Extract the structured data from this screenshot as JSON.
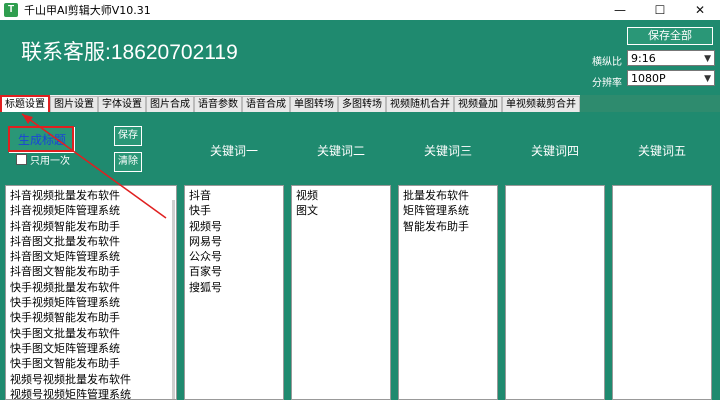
{
  "window": {
    "title": "千山甲AI剪辑大师V10.31",
    "icon_letter": "T",
    "min": "—",
    "max": "☐",
    "close": "✕"
  },
  "header": {
    "contact": "联系客服:18620702119",
    "save_all": "保存全部",
    "aspect_label": "横纵比",
    "aspect_value": "9:16",
    "resolution_label": "分辨率",
    "resolution_value": "1080P"
  },
  "tabs": [
    "标题设置",
    "图片设置",
    "字体设置",
    "图片合成",
    "语音参数",
    "语音合成",
    "单图转场",
    "多图转场",
    "视频随机合并",
    "视频叠加",
    "单视频裁剪合并"
  ],
  "main": {
    "generate_label": "生成标题",
    "save_label": "保存",
    "clear_label": "清除",
    "once_label": "只用一次",
    "keywords": [
      "关键词一",
      "关键词二",
      "关键词三",
      "关键词四",
      "关键词五"
    ],
    "titles": [
      "抖音视频批量发布软件",
      "抖音视频矩阵管理系统",
      "抖音视频智能发布助手",
      "抖音图文批量发布软件",
      "抖音图文矩阵管理系统",
      "抖音图文智能发布助手",
      "快手视频批量发布软件",
      "快手视频矩阵管理系统",
      "快手视频智能发布助手",
      "快手图文批量发布软件",
      "快手图文矩阵管理系统",
      "快手图文智能发布助手",
      "视频号视频批量发布软件",
      "视频号视频矩阵管理系统"
    ],
    "kw1": [
      "抖音",
      "快手",
      "视频号",
      "网易号",
      "公众号",
      "百家号",
      "搜狐号"
    ],
    "kw2": [
      "视频",
      "图文"
    ],
    "kw3": [
      "批量发布软件",
      "矩阵管理系统",
      "智能发布助手"
    ],
    "kw4": [],
    "kw5": []
  }
}
